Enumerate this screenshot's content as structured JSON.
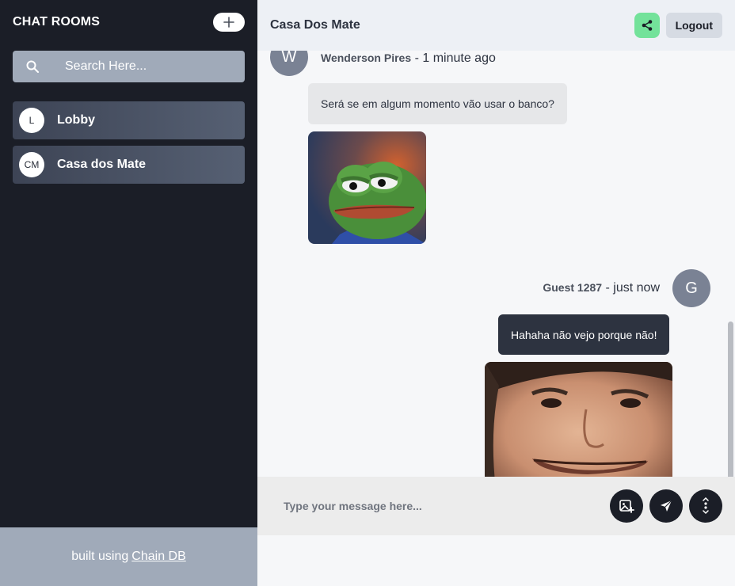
{
  "sidebar": {
    "title": "CHAT ROOMS",
    "search_placeholder": "Search Here...",
    "rooms": [
      {
        "initials": "L",
        "name": "Lobby"
      },
      {
        "initials": "CM",
        "name": "Casa dos Mate"
      }
    ],
    "footer_text": "built using",
    "footer_link": "Chain DB"
  },
  "header": {
    "room_title": "Casa Dos Mate",
    "logout_label": "Logout"
  },
  "messages": [
    {
      "initial": "W",
      "author": "Wenderson Pires",
      "time": "- 1 minute ago",
      "text": "Será se em algum momento vão usar o banco?",
      "image_icon": "sad-frog-meme-image"
    },
    {
      "initial": "G",
      "author": "Guest 1287",
      "time": "- just now",
      "text": "Hahaha não vejo porque não!",
      "image_icon": "smiling-man-meme-image"
    }
  ],
  "composer": {
    "placeholder": "Type your message here..."
  },
  "colors": {
    "sidebar_bg": "#1b1e27",
    "accent_share": "#73e29a",
    "outgoing_bubble": "#2d3340",
    "incoming_bubble": "#e6e7e9"
  }
}
